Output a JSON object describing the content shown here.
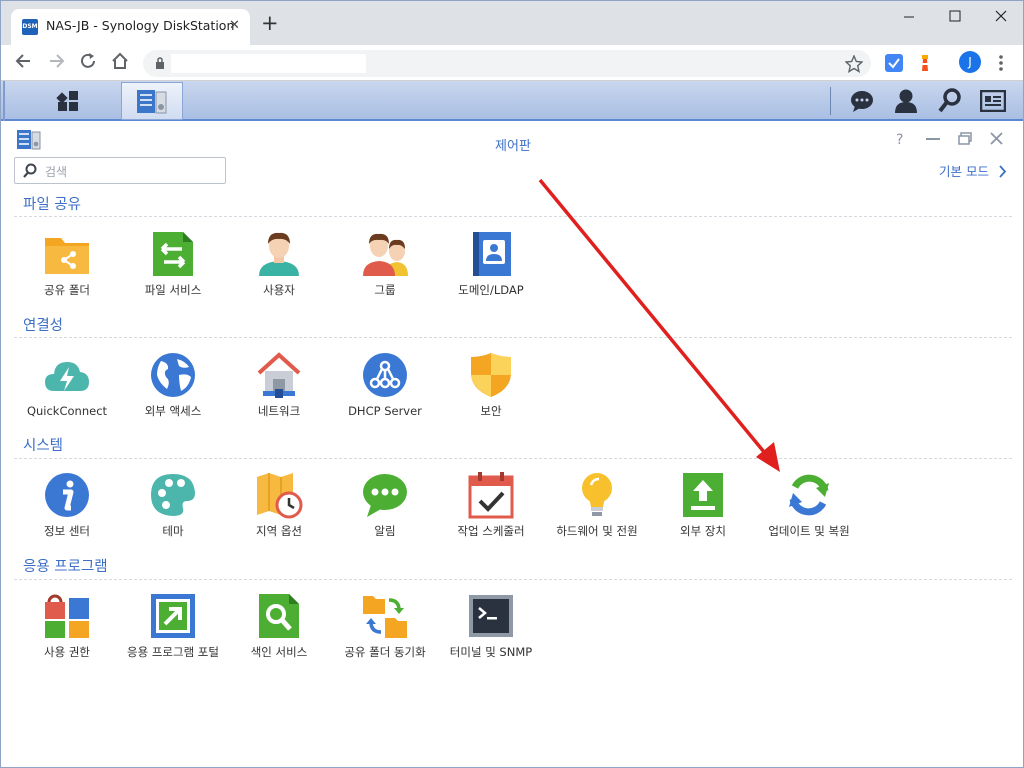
{
  "browser": {
    "tab_title": "NAS-JB - Synology DiskStation",
    "favicon_text": "DSM",
    "tab_close": "✕",
    "new_tab": "+",
    "profile_initial": "J"
  },
  "window": {
    "title": "제어판",
    "help": "?",
    "search_placeholder": "검색",
    "basic_mode": "기본 모드"
  },
  "sections": [
    {
      "title": "파일 공유",
      "items": [
        "공유 폴더",
        "파일 서비스",
        "사용자",
        "그룹",
        "도메인/LDAP"
      ]
    },
    {
      "title": "연결성",
      "items": [
        "QuickConnect",
        "외부 액세스",
        "네트워크",
        "DHCP Server",
        "보안"
      ]
    },
    {
      "title": "시스템",
      "items": [
        "정보 센터",
        "테마",
        "지역 옵션",
        "알림",
        "작업 스케줄러",
        "하드웨어 및 전원",
        "외부 장치",
        "업데이트 및 복원"
      ]
    },
    {
      "title": "응용 프로그램",
      "items": [
        "사용 권한",
        "응용 프로그램 포털",
        "색인 서비스",
        "공유 폴더 동기화",
        "터미널 및 SNMP"
      ]
    }
  ],
  "colors": {
    "accent": "#3d6fc7",
    "annotation_arrow": "#e0201e"
  },
  "icons": {
    "file_sharing": [
      "shared-folder-icon",
      "file-services-icon",
      "user-icon",
      "group-icon",
      "domain-ldap-icon"
    ],
    "connectivity": [
      "quickconnect-icon",
      "external-access-icon",
      "network-icon",
      "dhcp-server-icon",
      "security-icon"
    ],
    "system": [
      "info-center-icon",
      "theme-icon",
      "regional-options-icon",
      "notification-icon",
      "task-scheduler-icon",
      "hardware-power-icon",
      "external-devices-icon",
      "update-restore-icon"
    ],
    "applications": [
      "privileges-icon",
      "application-portal-icon",
      "indexing-service-icon",
      "shared-folder-sync-icon",
      "terminal-snmp-icon"
    ]
  }
}
